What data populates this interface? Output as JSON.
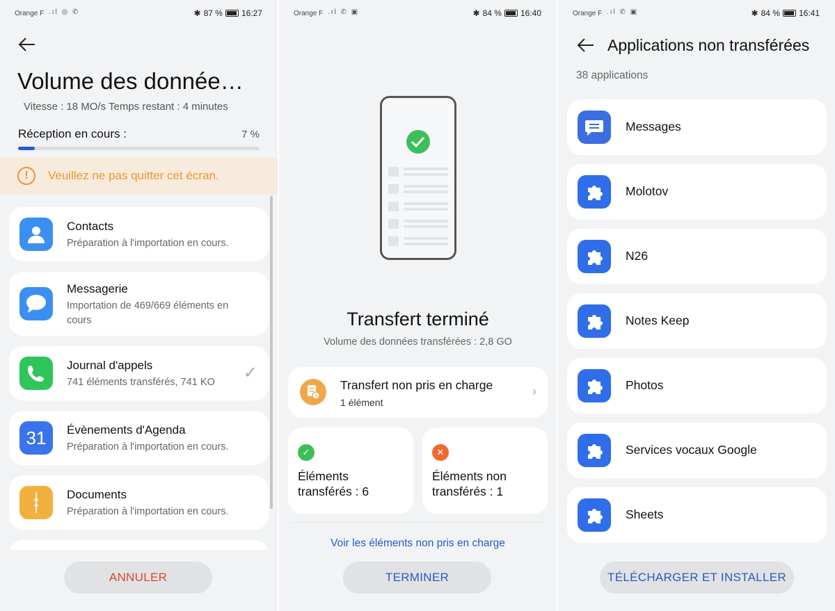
{
  "screen1": {
    "status": {
      "carrier": "Orange F",
      "battery": "87 %",
      "time": "16:27"
    },
    "title": "Volume des donnée…",
    "speed": "Vitesse : 18 MO/s  Temps restant : 4 minutes",
    "reception_label": "Réception en cours :",
    "progress_percent": 7,
    "progress_text": "7 %",
    "warning": "Veuillez ne pas quitter cet écran.",
    "items": [
      {
        "title": "Contacts",
        "subtitle": "Préparation à l'importation en cours.",
        "icon": "contacts-icon",
        "color": "#3b8ff0"
      },
      {
        "title": "Messagerie",
        "subtitle": "Importation de 469/669 éléments en cours",
        "icon": "messaging-icon",
        "color": "#3b8ff0"
      },
      {
        "title": "Journal d'appels",
        "subtitle": "741 éléments transférés, 741 KO",
        "icon": "phone-icon",
        "color": "#2fc55a",
        "done": true
      },
      {
        "title": "Évènements d'Agenda",
        "subtitle": "Préparation à l'importation en cours.",
        "icon": "calendar-icon",
        "color": "#3b74ea",
        "icon_text": "31"
      },
      {
        "title": "Documents",
        "subtitle": "Préparation à l'importation en cours.",
        "icon": "documents-icon",
        "color": "#f2b13f"
      }
    ],
    "cancel_label": "ANNULER",
    "cancel_color": "#e0432f"
  },
  "screen2": {
    "status": {
      "carrier": "Orange F",
      "battery": "84 %",
      "time": "16:40"
    },
    "title": "Transfert terminé",
    "subtitle": "Volume des données transférées : 2,8 GO",
    "unsupported": {
      "title": "Transfert non pris en charge",
      "count": "1 élément"
    },
    "transferred": {
      "line1": "Éléments",
      "line2": "transférés : 6"
    },
    "not_transferred": {
      "line1": "Éléments non",
      "line2": "transférés : 1"
    },
    "link": "Voir les éléments non pris en charge",
    "finish_label": "TERMINER",
    "accent": "#2a59c7"
  },
  "screen3": {
    "status": {
      "carrier": "Orange F",
      "battery": "84 %",
      "time": "16:41"
    },
    "title": "Applications non transférées",
    "count": "38 applications",
    "apps": [
      {
        "name": "Messages",
        "icon": "messages-icon"
      },
      {
        "name": "Molotov",
        "icon": "puzzle-icon"
      },
      {
        "name": "N26",
        "icon": "puzzle-icon"
      },
      {
        "name": "Notes Keep",
        "icon": "puzzle-icon"
      },
      {
        "name": "Photos",
        "icon": "puzzle-icon"
      },
      {
        "name": "Services vocaux Google",
        "icon": "puzzle-icon"
      },
      {
        "name": "Sheets",
        "icon": "puzzle-icon"
      }
    ],
    "download_label": "TÉLÉCHARGER ET INSTALLER"
  }
}
